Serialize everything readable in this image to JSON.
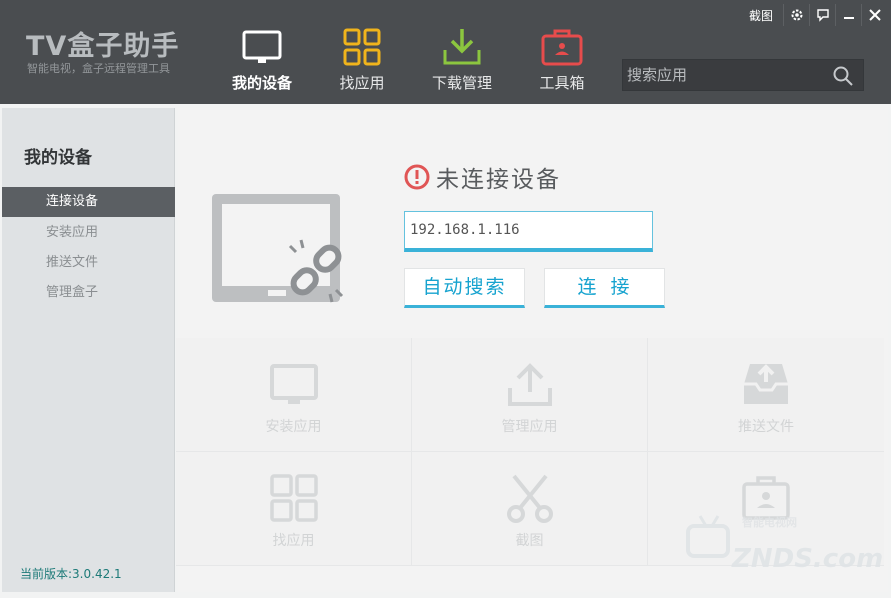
{
  "app": {
    "logo": "TV盒子助手",
    "tagline": "智能电视，盒子远程管理工具"
  },
  "window_controls": {
    "screenshot_label": "截图"
  },
  "nav": {
    "items": [
      {
        "label": "我的设备",
        "icon": "tv-icon",
        "active": true
      },
      {
        "label": "找应用",
        "icon": "grid-apps-icon",
        "active": false
      },
      {
        "label": "下载管理",
        "icon": "download-icon",
        "active": false
      },
      {
        "label": "工具箱",
        "icon": "toolbox-icon",
        "active": false
      }
    ]
  },
  "search": {
    "placeholder": "搜索应用",
    "value": ""
  },
  "sidebar": {
    "title": "我的设备",
    "items": [
      {
        "label": "连接设备",
        "active": true
      },
      {
        "label": "安装应用",
        "active": false
      },
      {
        "label": "推送文件",
        "active": false
      },
      {
        "label": "管理盒子",
        "active": false
      }
    ],
    "version": "当前版本:3.0.42.1"
  },
  "main": {
    "status_text": "未连接设备",
    "ip_value": "192.168.1.116",
    "auto_search_label": "自动搜索",
    "connect_label": "连接",
    "tiles": [
      {
        "label": "安装应用",
        "icon": "tv-icon"
      },
      {
        "label": "管理应用",
        "icon": "upload-icon"
      },
      {
        "label": "推送文件",
        "icon": "inbox-push-icon"
      },
      {
        "label": "找应用",
        "icon": "grid-apps-icon"
      },
      {
        "label": "截图",
        "icon": "scissors-icon"
      },
      {
        "label": "",
        "icon": "toolbox-icon"
      }
    ]
  },
  "watermark": {
    "line1": "智能电视网",
    "line2": "ZNDS.com"
  },
  "colors": {
    "header_bg": "#4a4d50",
    "accent_blue": "#3ab2d8",
    "status_red": "#e05555",
    "nav_yellow": "#f0b41c",
    "nav_green": "#8cc63f",
    "nav_red": "#e74c4c"
  }
}
